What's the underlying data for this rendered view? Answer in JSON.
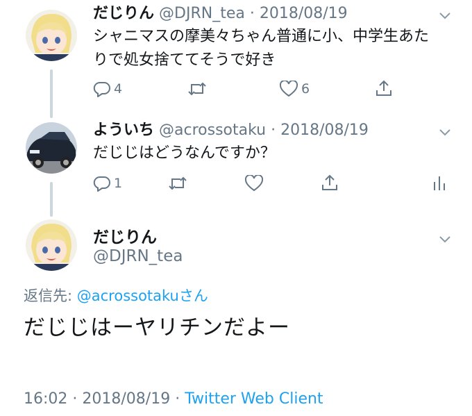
{
  "tweets": [
    {
      "name": "だじりん",
      "handle": "@DJRN_tea",
      "sep": "·",
      "date": "2018/08/19",
      "text_line1": "シャニマスの摩美々ちゃん普通に小、中学生あた",
      "text_line2": "りで処女捨ててそうで好き",
      "reply_count": "4",
      "like_count": "6"
    },
    {
      "name": "よういち",
      "handle": "@acrossotaku",
      "sep": "·",
      "date": "2018/08/19",
      "text": "だじじはどうなんですか？",
      "reply_count": "1"
    }
  ],
  "focused": {
    "name": "だじりん",
    "handle": "@DJRN_tea",
    "reply_prefix": "返信先: ",
    "reply_handle": "@acrossotaku",
    "reply_suffix": "さん",
    "text": "だじじはーヤリチンだよー",
    "time": "16:02",
    "sep1": " · ",
    "date": "2018/08/19",
    "sep2": " · ",
    "client": "Twitter Web Client"
  },
  "icons": {
    "reply": "reply-icon",
    "retweet": "retweet-icon",
    "like": "heart-icon",
    "share": "share-icon",
    "analytics": "analytics-icon",
    "caret": "chevron-down-icon"
  },
  "colors": {
    "text": "#14171a",
    "secondary": "#657786",
    "link": "#1da1f2",
    "thread_line": "#ccd6dd"
  }
}
